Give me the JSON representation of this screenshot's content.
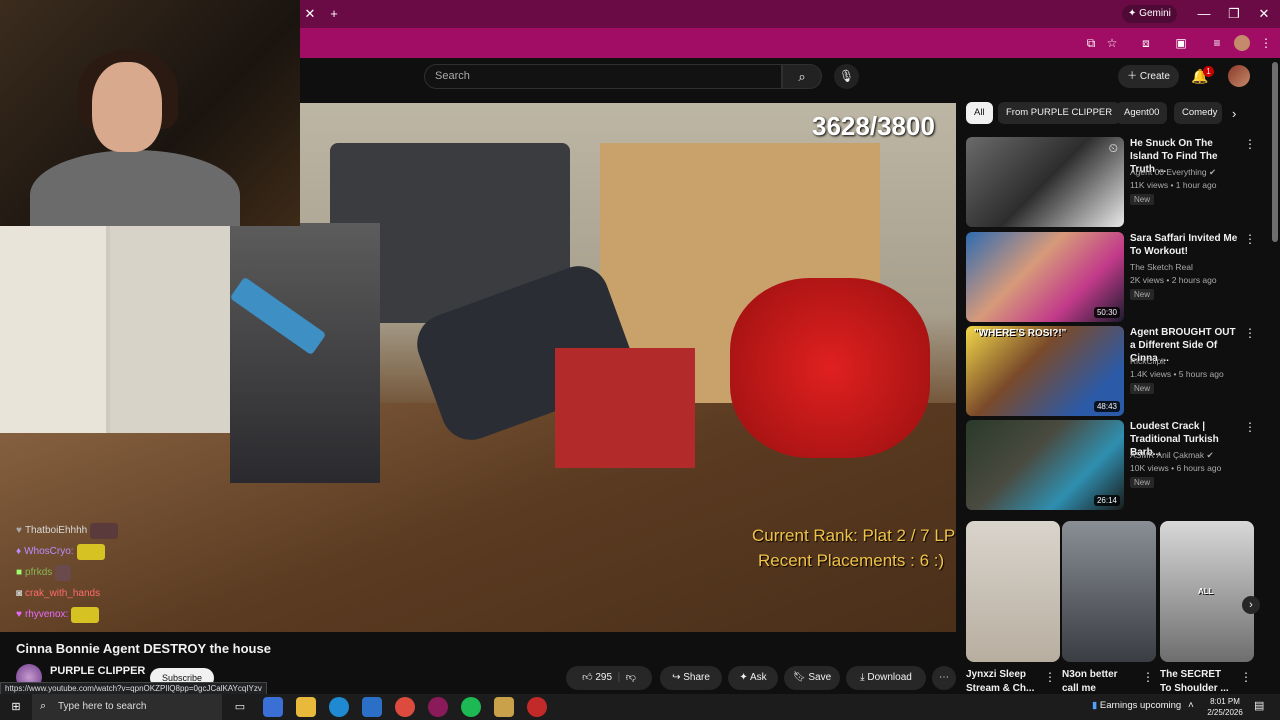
{
  "browser": {
    "gemini_label": "Gemini",
    "new_tab_symbol": "+",
    "close_tab_symbol": "✕"
  },
  "header": {
    "search_placeholder": "Search",
    "create_label": "Create",
    "notification_count": "1"
  },
  "video": {
    "counter": "3628/3800",
    "rank_line1": "Current Rank: Plat 2 / 7 LP",
    "rank_line2": "Recent Placements : 6 :)",
    "chat": [
      {
        "user": "ThatboiEhhhh",
        "color": "#d9d9d9"
      },
      {
        "user": "WhosCryo:",
        "color": "#b98cff"
      },
      {
        "user": "pfrkds",
        "color": "#9cff6b"
      },
      {
        "user": "crak_with_hands",
        "color": "#ff6b6b"
      },
      {
        "user": "rhyvenox:",
        "color": "#e86bff"
      }
    ],
    "title": "Cinna Bonnie Agent DESTROY the house",
    "channel": "PURPLE CLIPPER",
    "subscribe_label": "Subscribe",
    "status_url": "https://www.youtube.com/watch?v=qpnOKZPIlQ8pp=0gcJCalKAYcqIYzv"
  },
  "actions": {
    "likes": "295",
    "share": "Share",
    "ask": "Ask",
    "save": "Save",
    "download": "Download"
  },
  "chips": [
    "All",
    "From PURPLE CLIPPER",
    "Agent00",
    "Comedy"
  ],
  "recommendations": [
    {
      "title": "He Snuck On The Island To Find The Truth ...",
      "channel": "Agent 00 Everything",
      "verified": true,
      "meta": "11K views • 1 hour ago",
      "badge": "New",
      "duration": ""
    },
    {
      "title": "Sara Saffari Invited Me To Workout!",
      "channel": "The Sketch Real",
      "verified": false,
      "meta": "2K views • 2 hours ago",
      "badge": "New",
      "duration": "50:30"
    },
    {
      "title": "Agent BROUGHT OUT a Different Side Of Cinna ...",
      "channel": "RickClipit",
      "verified": false,
      "meta": "1.4K views • 5 hours ago",
      "badge": "New",
      "duration": "48:43"
    },
    {
      "title": "Loudest Crack | Traditional Turkish Barb...",
      "channel": "ASMR Anil Çakmak",
      "verified": true,
      "meta": "10K views • 6 hours ago",
      "badge": "New",
      "duration": "26:14"
    }
  ],
  "shorts": [
    {
      "title": "Jynxzi Sleep Stream & Ch...",
      "overlay": ""
    },
    {
      "title": "N3on better call me",
      "overlay": ""
    },
    {
      "title": "The SECRET To Shoulder ...",
      "overlay": "ALL"
    }
  ],
  "thumb_overlay_text": "\"WHERE'S ROSI?!\"",
  "taskbar": {
    "search_placeholder": "Type here to search",
    "tray_text": "Earnings upcoming",
    "time": "8:01 PM",
    "date": "2/25/2026"
  }
}
